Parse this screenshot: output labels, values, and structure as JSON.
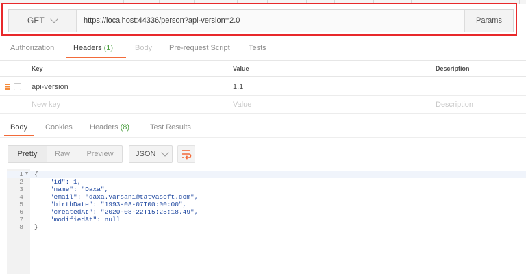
{
  "request": {
    "method": "GET",
    "url": "https://localhost:44336/person?api-version=2.0",
    "params_label": "Params"
  },
  "request_tabs": [
    {
      "label": "Authorization",
      "state": "normal"
    },
    {
      "label": "Headers",
      "count": "(1)",
      "state": "active"
    },
    {
      "label": "Body",
      "state": "disabled"
    },
    {
      "label": "Pre-request Script",
      "state": "normal"
    },
    {
      "label": "Tests",
      "state": "normal"
    }
  ],
  "headers_table": {
    "columns": [
      "Key",
      "Value",
      "Description"
    ],
    "rows": [
      {
        "key": "api-version",
        "value": "1.1",
        "description": ""
      }
    ],
    "new_row": {
      "key": "New key",
      "value": "Value",
      "description": "Description"
    }
  },
  "response_tabs": [
    {
      "label": "Body",
      "state": "active"
    },
    {
      "label": "Cookies",
      "state": "normal"
    },
    {
      "label": "Headers",
      "count": "(8)",
      "state": "normal"
    },
    {
      "label": "Test Results",
      "state": "normal"
    }
  ],
  "response_toolbar": {
    "views": [
      "Pretty",
      "Raw",
      "Preview"
    ],
    "selected_view": "Pretty",
    "format": "JSON",
    "wrap_icon": "wrap-lines-icon"
  },
  "response_body": {
    "line_numbers": [
      "1",
      "2",
      "3",
      "4",
      "5",
      "6",
      "7",
      "8"
    ],
    "lines": [
      "{",
      "    \"id\": 1,",
      "    \"name\": \"Daxa\",",
      "    \"email\": \"daxa.varsani@tatvasoft.com\",",
      "    \"birthDate\": \"1993-08-07T00:00:00\",",
      "    \"createdAt\": \"2020-08-22T15:25:18.49\",",
      "    \"modifiedAt\": null",
      "}"
    ]
  },
  "colors": {
    "highlight_border": "#e8292b",
    "active_tab_underline": "#f26b3a",
    "count_green": "#4a9f3f",
    "drag_handle": "#f48b3b"
  }
}
